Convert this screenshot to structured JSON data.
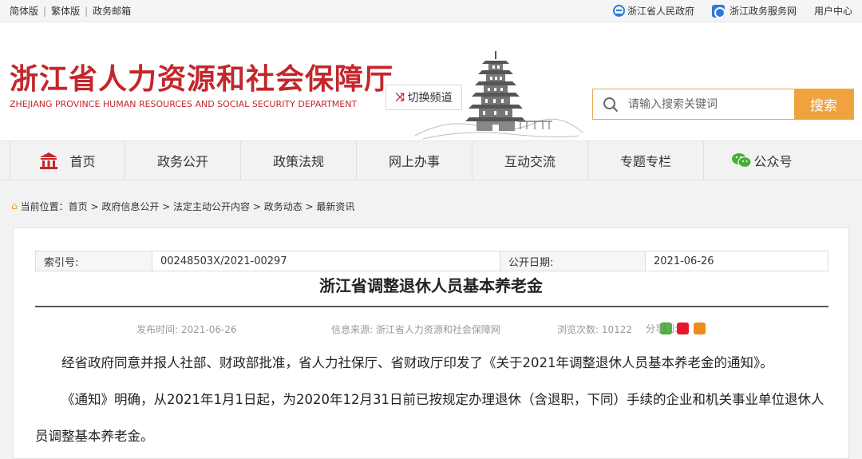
{
  "topbar": {
    "simplified": "简体版",
    "traditional": "繁体版",
    "mail": "政务邮箱",
    "gov": "浙江省人民政府",
    "service": "浙江政务服务网",
    "user": "用户中心"
  },
  "header": {
    "title": "浙江省人力资源和社会保障厅",
    "subtitle": "ZHEJIANG PROVINCE HUMAN RESOURCES AND SOCIAL SECURITY DEPARTMENT",
    "switch_label": "切换频道"
  },
  "search": {
    "placeholder": "请输入搜索关键词",
    "button": "搜索"
  },
  "nav": {
    "items": [
      "首页",
      "政务公开",
      "政策法规",
      "网上办事",
      "互动交流",
      "专题专栏",
      "公众号"
    ]
  },
  "breadcrumb": {
    "label": "当前位置：",
    "path": "首页 > 政府信息公开 > 法定主动公开内容 > 政务动态 > 最新资讯"
  },
  "meta": {
    "index_label": "索引号:",
    "index_value": "00248503X/2021-00297",
    "date_label": "公开日期:",
    "date_value": "2021-06-26"
  },
  "article": {
    "title": "浙江省调整退休人员基本养老金",
    "publish_time": "发布时间: 2021-06-26",
    "source": "信息来源: 浙江省人力资源和社会保障网",
    "views": "浏览次数: 10122",
    "share": "分享到:",
    "para1": "经省政府同意并报人社部、财政部批准，省人力社保厅、省财政厅印发了《关于2021年调整退休人员基本养老金的通知》。",
    "para2": "《通知》明确，从2021年1月1日起，为2020年12月31日前已按规定办理退休（含退职，下同）手续的企业和机关事业单位退休人员调整基本养老金。"
  },
  "colors": {
    "brand_red": "#c3272b",
    "accent_orange": "#f0a33d",
    "link_blue": "#2b7bd8"
  }
}
